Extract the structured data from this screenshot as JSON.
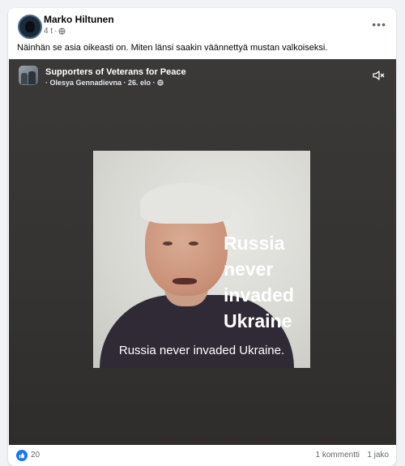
{
  "post": {
    "author": "Marko Hiltunen",
    "time": "4 t",
    "separator": "·",
    "text": "Näinhän se asia oikeasti on. Miten länsi saakin väännettyä mustan valkoiseksi."
  },
  "shared": {
    "page_name": "Supporters of Veterans for Peace",
    "meta": "· Olesya Gennadievna · 26. elo ·",
    "overlay_text": "Russia never invaded Ukraine",
    "caption": "Russia never invaded Ukraine."
  },
  "footer": {
    "likes": "20",
    "comments": "1 kommentti",
    "shares": "1 jako"
  },
  "icons": {
    "more": "more-options-icon",
    "privacy": "globe-icon",
    "mute": "speaker-muted-icon",
    "like": "like-thumb-icon"
  },
  "colors": {
    "like_blue": "#1877f2",
    "text_primary": "#050505",
    "text_secondary": "#65676b"
  }
}
